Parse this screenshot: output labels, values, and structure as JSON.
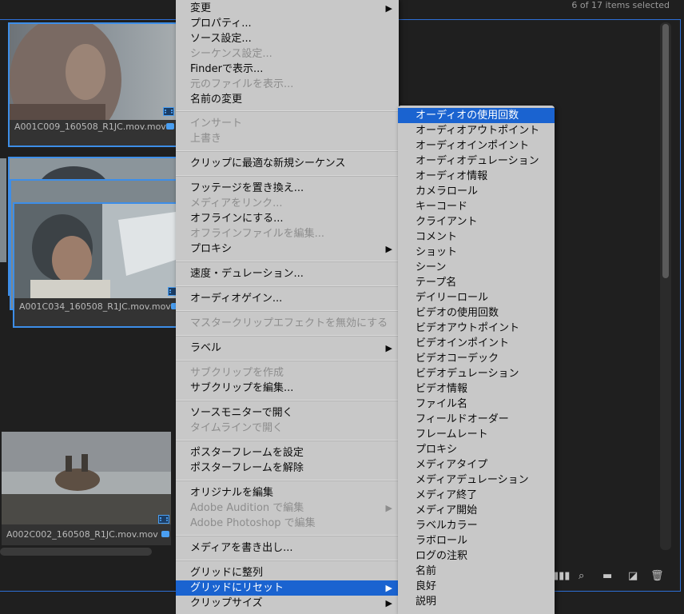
{
  "panel": {
    "items_selected": "6 of 17 items selected"
  },
  "clips": [
    {
      "name": "A001C009_160508_R1JC.mov.mov",
      "selected": true
    },
    {
      "name": "A001C034_160508_R1JC.mov.mov",
      "selected": true
    },
    {
      "name": "A002C002_160508_R1JC.mov.mov",
      "selected": false
    }
  ],
  "menu": {
    "items": [
      {
        "label": "変更",
        "disabled": false,
        "submenu": true
      },
      {
        "label": "プロパティ...",
        "disabled": false
      },
      {
        "label": "ソース設定...",
        "disabled": false
      },
      {
        "label": "シーケンス設定...",
        "disabled": true
      },
      {
        "label": "Finderで表示...",
        "disabled": false
      },
      {
        "label": "元のファイルを表示...",
        "disabled": true
      },
      {
        "label": "名前の変更",
        "disabled": false
      },
      {
        "label": "インサート",
        "disabled": true
      },
      {
        "label": "上書き",
        "disabled": true
      },
      {
        "label": "クリップに最適な新規シーケンス",
        "disabled": false
      },
      {
        "label": "フッテージを置き換え...",
        "disabled": false
      },
      {
        "label": "メディアをリンク...",
        "disabled": true
      },
      {
        "label": "オフラインにする...",
        "disabled": false
      },
      {
        "label": "オフラインファイルを編集...",
        "disabled": true
      },
      {
        "label": "プロキシ",
        "disabled": false,
        "submenu": true
      },
      {
        "label": "速度・デュレーション...",
        "disabled": false
      },
      {
        "label": "オーディオゲイン...",
        "disabled": false
      },
      {
        "label": "マスタークリップエフェクトを無効にする",
        "disabled": true
      },
      {
        "label": "ラベル",
        "disabled": false,
        "submenu": true
      },
      {
        "label": "サブクリップを作成",
        "disabled": true
      },
      {
        "label": "サブクリップを編集...",
        "disabled": false
      },
      {
        "label": "ソースモニターで開く",
        "disabled": false
      },
      {
        "label": "タイムラインで開く",
        "disabled": true
      },
      {
        "label": "ポスターフレームを設定",
        "disabled": false
      },
      {
        "label": "ポスターフレームを解除",
        "disabled": false
      },
      {
        "label": "オリジナルを編集",
        "disabled": false
      },
      {
        "label": "Adobe Audition で編集",
        "disabled": true,
        "submenu": true
      },
      {
        "label": "Adobe Photoshop で編集",
        "disabled": true
      },
      {
        "label": "メディアを書き出し...",
        "disabled": false
      },
      {
        "label": "グリッドに整列",
        "disabled": false
      },
      {
        "label": "グリッドにリセット",
        "disabled": false,
        "submenu": true,
        "highlighted": true
      },
      {
        "label": "クリップサイズ",
        "disabled": false,
        "submenu": true
      }
    ],
    "arrow": "▶"
  },
  "submenu": {
    "items": [
      "オーディオの使用回数",
      "オーディオアウトポイント",
      "オーディオインポイント",
      "オーディオデュレーション",
      "オーディオ情報",
      "カメラロール",
      "キーコード",
      "クライアント",
      "コメント",
      "ショット",
      "シーン",
      "テープ名",
      "デイリーロール",
      "ビデオの使用回数",
      "ビデオアウトポイント",
      "ビデオインポイント",
      "ビデオコーデック",
      "ビデオデュレーション",
      "ビデオ情報",
      "ファイル名",
      "フィールドオーダー",
      "フレームレート",
      "プロキシ",
      "メディアタイプ",
      "メディアデュレーション",
      "メディア終了",
      "メディア開始",
      "ラベルカラー",
      "ラボロール",
      "ログの注釈",
      "名前",
      "良好",
      "説明"
    ],
    "highlighted_index": 0
  },
  "toolbar": {
    "icons": [
      "list-view-icon",
      "search-icon",
      "folder-icon",
      "new-item-icon",
      "trash-icon"
    ]
  }
}
